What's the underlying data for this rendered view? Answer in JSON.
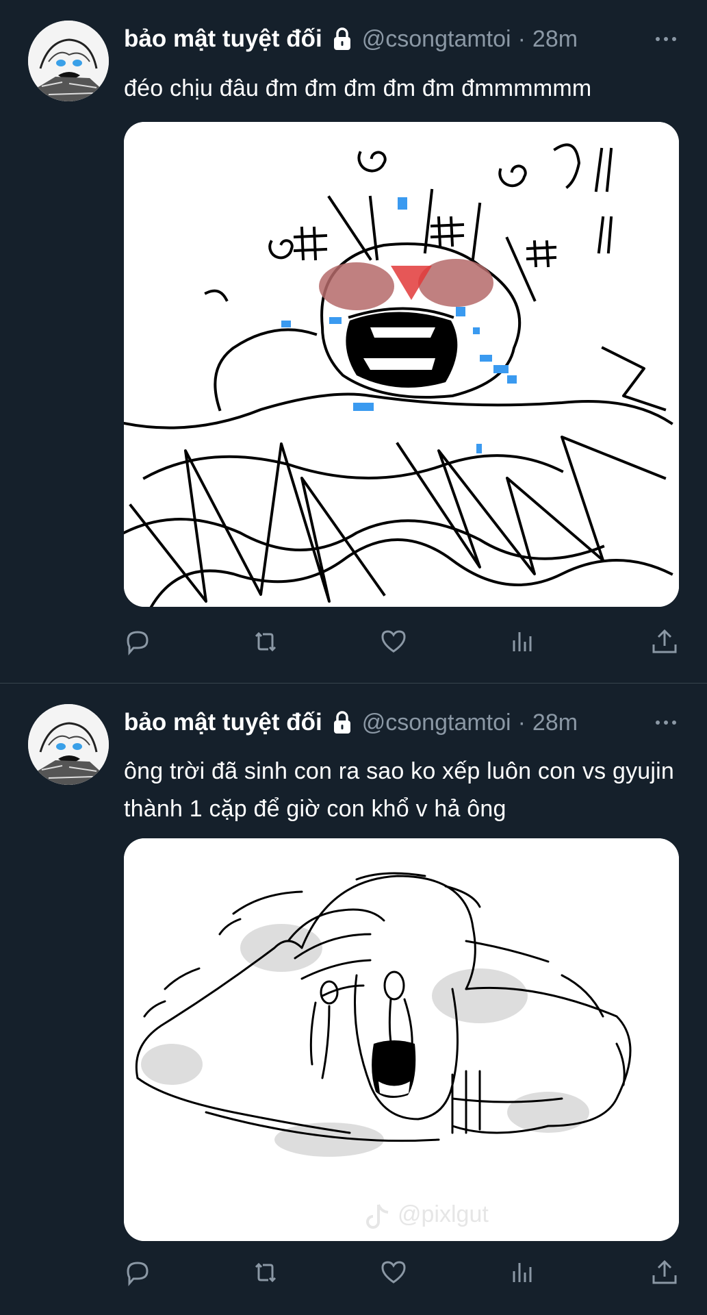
{
  "tweets": [
    {
      "display_name": "bảo mật tuyệt đối",
      "handle": "@csongtamtoi",
      "separator": "·",
      "time": "28m",
      "text": "đéo chịu đâu đm đm đm đm đm đmmmmmm",
      "media_icon": "doodle-crying-scribble",
      "avatar_icon": "crying-doodle-avatar"
    },
    {
      "display_name": "bảo mật tuyệt đối",
      "handle": "@csongtamtoi",
      "separator": "·",
      "time": "28m",
      "text": "ông trời đã sinh con ra sao ko xếp luôn con vs gyujin thành 1 cặp để giờ con khổ v hả ông",
      "media_icon": "doodle-crying-head-in-hand",
      "media_watermark": "@pixlgut",
      "avatar_icon": "crying-doodle-avatar"
    }
  ],
  "action_icons": [
    "reply-icon",
    "retweet-icon",
    "like-icon",
    "views-icon",
    "share-icon"
  ],
  "colors": {
    "background": "#15202b",
    "secondary_text": "#8b98a5",
    "divider": "#38444d",
    "text": "#ffffff"
  }
}
